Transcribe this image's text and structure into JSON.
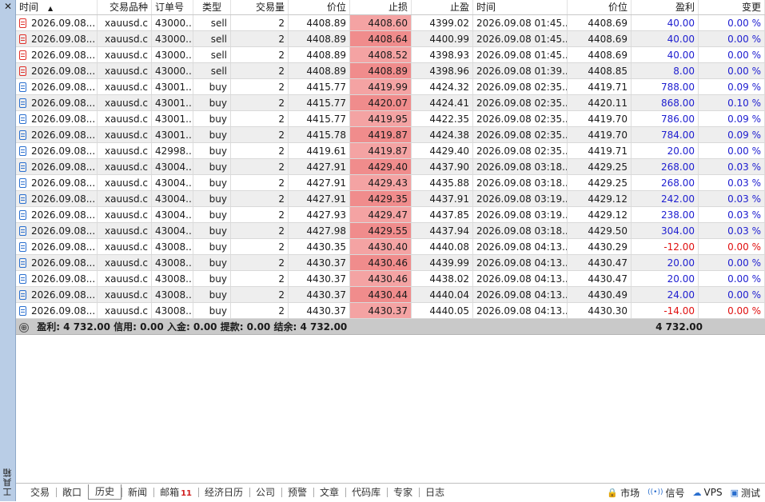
{
  "side": {
    "close": "✕",
    "label": "工具箱"
  },
  "columns": [
    "时间",
    "交易品种",
    "订单号",
    "类型",
    "交易量",
    "价位",
    "止损",
    "止盈",
    "时间",
    "价位",
    "盈利",
    "变更"
  ],
  "sort_indicator": "▲",
  "rows": [
    {
      "open_time": "2026.09.08...",
      "symbol": "xauusd.c",
      "order": "43000...",
      "type": "sell",
      "volume": "2",
      "open_price": "4408.89",
      "sl": "4408.60",
      "tp": "4399.02",
      "close_time": "2026.09.08 01:45...",
      "close_price": "4408.69",
      "profit": "40.00",
      "change": "0.00 %",
      "profit_sign": "pos"
    },
    {
      "open_time": "2026.09.08...",
      "symbol": "xauusd.c",
      "order": "43000...",
      "type": "sell",
      "volume": "2",
      "open_price": "4408.89",
      "sl": "4408.64",
      "tp": "4400.99",
      "close_time": "2026.09.08 01:45...",
      "close_price": "4408.69",
      "profit": "40.00",
      "change": "0.00 %",
      "profit_sign": "pos"
    },
    {
      "open_time": "2026.09.08...",
      "symbol": "xauusd.c",
      "order": "43000...",
      "type": "sell",
      "volume": "2",
      "open_price": "4408.89",
      "sl": "4408.52",
      "tp": "4398.93",
      "close_time": "2026.09.08 01:45...",
      "close_price": "4408.69",
      "profit": "40.00",
      "change": "0.00 %",
      "profit_sign": "pos"
    },
    {
      "open_time": "2026.09.08...",
      "symbol": "xauusd.c",
      "order": "43000...",
      "type": "sell",
      "volume": "2",
      "open_price": "4408.89",
      "sl": "4408.89",
      "tp": "4398.96",
      "close_time": "2026.09.08 01:39...",
      "close_price": "4408.85",
      "profit": "8.00",
      "change": "0.00 %",
      "profit_sign": "pos"
    },
    {
      "open_time": "2026.09.08...",
      "symbol": "xauusd.c",
      "order": "43001...",
      "type": "buy",
      "volume": "2",
      "open_price": "4415.77",
      "sl": "4419.99",
      "tp": "4424.32",
      "close_time": "2026.09.08 02:35...",
      "close_price": "4419.71",
      "profit": "788.00",
      "change": "0.09 %",
      "profit_sign": "pos"
    },
    {
      "open_time": "2026.09.08...",
      "symbol": "xauusd.c",
      "order": "43001...",
      "type": "buy",
      "volume": "2",
      "open_price": "4415.77",
      "sl": "4420.07",
      "tp": "4424.41",
      "close_time": "2026.09.08 02:35...",
      "close_price": "4420.11",
      "profit": "868.00",
      "change": "0.10 %",
      "profit_sign": "pos"
    },
    {
      "open_time": "2026.09.08...",
      "symbol": "xauusd.c",
      "order": "43001...",
      "type": "buy",
      "volume": "2",
      "open_price": "4415.77",
      "sl": "4419.95",
      "tp": "4422.35",
      "close_time": "2026.09.08 02:35...",
      "close_price": "4419.70",
      "profit": "786.00",
      "change": "0.09 %",
      "profit_sign": "pos"
    },
    {
      "open_time": "2026.09.08...",
      "symbol": "xauusd.c",
      "order": "43001...",
      "type": "buy",
      "volume": "2",
      "open_price": "4415.78",
      "sl": "4419.87",
      "tp": "4424.38",
      "close_time": "2026.09.08 02:35...",
      "close_price": "4419.70",
      "profit": "784.00",
      "change": "0.09 %",
      "profit_sign": "pos"
    },
    {
      "open_time": "2026.09.08...",
      "symbol": "xauusd.c",
      "order": "42998...",
      "type": "buy",
      "volume": "2",
      "open_price": "4419.61",
      "sl": "4419.87",
      "tp": "4429.40",
      "close_time": "2026.09.08 02:35...",
      "close_price": "4419.71",
      "profit": "20.00",
      "change": "0.00 %",
      "profit_sign": "pos"
    },
    {
      "open_time": "2026.09.08...",
      "symbol": "xauusd.c",
      "order": "43004...",
      "type": "buy",
      "volume": "2",
      "open_price": "4427.91",
      "sl": "4429.40",
      "tp": "4437.90",
      "close_time": "2026.09.08 03:18...",
      "close_price": "4429.25",
      "profit": "268.00",
      "change": "0.03 %",
      "profit_sign": "pos"
    },
    {
      "open_time": "2026.09.08...",
      "symbol": "xauusd.c",
      "order": "43004...",
      "type": "buy",
      "volume": "2",
      "open_price": "4427.91",
      "sl": "4429.43",
      "tp": "4435.88",
      "close_time": "2026.09.08 03:18...",
      "close_price": "4429.25",
      "profit": "268.00",
      "change": "0.03 %",
      "profit_sign": "pos"
    },
    {
      "open_time": "2026.09.08...",
      "symbol": "xauusd.c",
      "order": "43004...",
      "type": "buy",
      "volume": "2",
      "open_price": "4427.91",
      "sl": "4429.35",
      "tp": "4437.91",
      "close_time": "2026.09.08 03:19...",
      "close_price": "4429.12",
      "profit": "242.00",
      "change": "0.03 %",
      "profit_sign": "pos"
    },
    {
      "open_time": "2026.09.08...",
      "symbol": "xauusd.c",
      "order": "43004...",
      "type": "buy",
      "volume": "2",
      "open_price": "4427.93",
      "sl": "4429.47",
      "tp": "4437.85",
      "close_time": "2026.09.08 03:19...",
      "close_price": "4429.12",
      "profit": "238.00",
      "change": "0.03 %",
      "profit_sign": "pos"
    },
    {
      "open_time": "2026.09.08...",
      "symbol": "xauusd.c",
      "order": "43004...",
      "type": "buy",
      "volume": "2",
      "open_price": "4427.98",
      "sl": "4429.55",
      "tp": "4437.94",
      "close_time": "2026.09.08 03:18...",
      "close_price": "4429.50",
      "profit": "304.00",
      "change": "0.03 %",
      "profit_sign": "pos"
    },
    {
      "open_time": "2026.09.08...",
      "symbol": "xauusd.c",
      "order": "43008...",
      "type": "buy",
      "volume": "2",
      "open_price": "4430.35",
      "sl": "4430.40",
      "tp": "4440.08",
      "close_time": "2026.09.08 04:13...",
      "close_price": "4430.29",
      "profit": "-12.00",
      "change": "0.00 %",
      "profit_sign": "neg"
    },
    {
      "open_time": "2026.09.08...",
      "symbol": "xauusd.c",
      "order": "43008...",
      "type": "buy",
      "volume": "2",
      "open_price": "4430.37",
      "sl": "4430.46",
      "tp": "4439.99",
      "close_time": "2026.09.08 04:13...",
      "close_price": "4430.47",
      "profit": "20.00",
      "change": "0.00 %",
      "profit_sign": "pos"
    },
    {
      "open_time": "2026.09.08...",
      "symbol": "xauusd.c",
      "order": "43008...",
      "type": "buy",
      "volume": "2",
      "open_price": "4430.37",
      "sl": "4430.46",
      "tp": "4438.02",
      "close_time": "2026.09.08 04:13...",
      "close_price": "4430.47",
      "profit": "20.00",
      "change": "0.00 %",
      "profit_sign": "pos"
    },
    {
      "open_time": "2026.09.08...",
      "symbol": "xauusd.c",
      "order": "43008...",
      "type": "buy",
      "volume": "2",
      "open_price": "4430.37",
      "sl": "4430.44",
      "tp": "4440.04",
      "close_time": "2026.09.08 04:13...",
      "close_price": "4430.49",
      "profit": "24.00",
      "change": "0.00 %",
      "profit_sign": "pos"
    },
    {
      "open_time": "2026.09.08...",
      "symbol": "xauusd.c",
      "order": "43008...",
      "type": "buy",
      "volume": "2",
      "open_price": "4430.37",
      "sl": "4430.37",
      "tp": "4440.05",
      "close_time": "2026.09.08 04:13...",
      "close_price": "4430.30",
      "profit": "-14.00",
      "change": "0.00 %",
      "profit_sign": "neg"
    }
  ],
  "summary": {
    "expand_symbol": "⊕",
    "text": "盈利: 4 732.00  信用: 0.00  入金: 0.00  提款: 0.00  结余: 4 732.00",
    "total_profit": "4 732.00"
  },
  "tabs": [
    {
      "label": "交易",
      "active": false
    },
    {
      "label": "敞口",
      "active": false
    },
    {
      "label": "历史",
      "active": true
    },
    {
      "label": "新闻",
      "active": false
    },
    {
      "label": "邮箱",
      "active": false,
      "badge": "11"
    },
    {
      "label": "经济日历",
      "active": false
    },
    {
      "label": "公司",
      "active": false
    },
    {
      "label": "预警",
      "active": false
    },
    {
      "label": "文章",
      "active": false
    },
    {
      "label": "代码库",
      "active": false
    },
    {
      "label": "专家",
      "active": false
    },
    {
      "label": "日志",
      "active": false
    }
  ],
  "status": [
    {
      "label": "市场",
      "icon": "lock-icon",
      "glyph": "🔒"
    },
    {
      "label": "信号",
      "icon": "signal-icon",
      "glyph": "((•))"
    },
    {
      "label": "VPS",
      "icon": "cloud-icon",
      "glyph": "☁"
    },
    {
      "label": "测试",
      "icon": "chip-icon",
      "glyph": "▣"
    }
  ],
  "colors": {
    "stop_loss_bg": "#f4a3a3",
    "profit_positive": "#1d1dd0",
    "profit_negative": "#e01010",
    "sidebar": "#b9cde6",
    "summary_bg": "#c9c9c9"
  }
}
